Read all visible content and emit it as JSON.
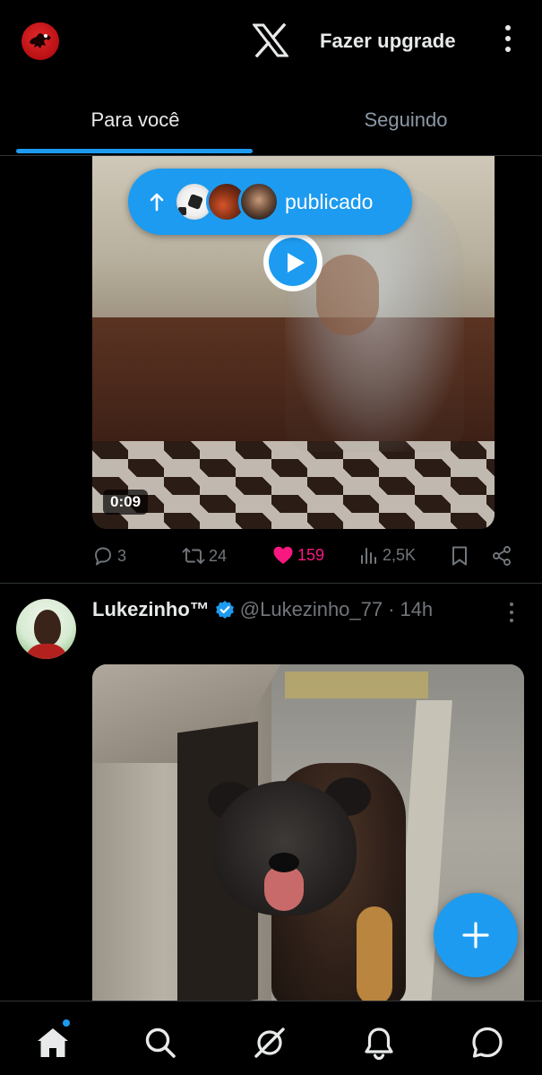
{
  "header": {
    "upgrade_label": "Fazer upgrade",
    "logo_icon": "x-logo-icon",
    "profile_icon": "profile-avatar",
    "menu_icon": "more-vertical-icon"
  },
  "tabs": [
    {
      "label": "Para você",
      "active": true
    },
    {
      "label": "Seguindo",
      "active": false
    }
  ],
  "post1": {
    "video_duration": "0:09",
    "published_pill": {
      "label": "publicado",
      "icon": "arrow-up-icon"
    },
    "stats": {
      "replies": "3",
      "reposts": "24",
      "likes": "159",
      "views": "2,5K"
    },
    "liked": true
  },
  "post2": {
    "author_name": "Lukezinho™",
    "handle": "@Lukezinho_77",
    "separator": "·",
    "time": "14h",
    "verified": true
  },
  "fab": {
    "icon": "plus-icon"
  },
  "bottom_nav": [
    {
      "icon": "home-icon",
      "active": true,
      "has_dot": true
    },
    {
      "icon": "search-icon"
    },
    {
      "icon": "grok-icon"
    },
    {
      "icon": "bell-icon"
    },
    {
      "icon": "messages-icon"
    }
  ],
  "colors": {
    "accent": "#1d9bf0",
    "like": "#f91880",
    "muted": "#71767b",
    "background": "#000000",
    "text": "#e7e9ea"
  }
}
